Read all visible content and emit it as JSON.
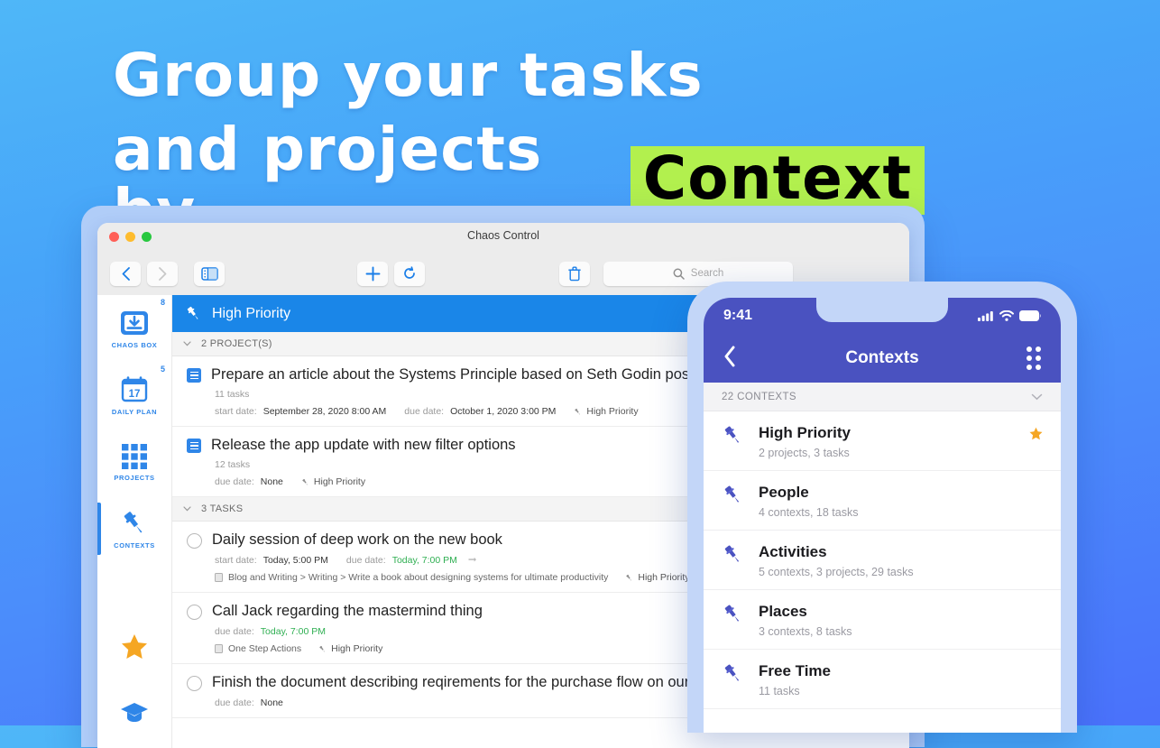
{
  "headline": {
    "line1": "Group your tasks",
    "line2_prefix": "and projects by",
    "line2_highlight": "Context",
    "highlight_color": "#b2f04e"
  },
  "desktop": {
    "window_title": "Chaos Control",
    "toolbar": {
      "back_icon": "chevron-left-icon",
      "forward_icon": "chevron-right-icon",
      "sidebar_toggle_icon": "sidebar-toggle-icon",
      "add_icon": "plus-icon",
      "sync_icon": "refresh-icon",
      "delete_icon": "trash-icon",
      "search_icon": "search-icon",
      "search_placeholder": "Search",
      "search_value": ""
    },
    "sidebar": {
      "items": [
        {
          "label": "CHAOS BOX",
          "badge": "8",
          "icon": "inbox-download-icon",
          "active": false
        },
        {
          "label": "DAILY PLAN",
          "badge": "5",
          "icon": "calendar-17-icon",
          "active": false
        },
        {
          "label": "PROJECTS",
          "badge": "",
          "icon": "grid-icon",
          "active": false
        },
        {
          "label": "CONTEXTS",
          "badge": "",
          "icon": "pin-icon",
          "active": true
        }
      ],
      "extras": [
        {
          "icon": "star-icon",
          "color": "#f5a623"
        },
        {
          "icon": "graduation-cap-icon",
          "color": "#2f86e8"
        }
      ]
    },
    "context_header": {
      "title": "High Priority",
      "icon": "pin-icon",
      "color": "#1a86e8"
    },
    "groups": [
      {
        "label": "2 PROJECT(S)",
        "chevron": "chevron-down-icon",
        "rows": [
          {
            "kind": "project",
            "title": "Prepare an article about the Systems Principle based on Seth Godin posts",
            "subtitle": "11 tasks",
            "meta": [
              {
                "key": "start date:",
                "value": "September 28, 2020 8:00 AM"
              },
              {
                "key": "due date:",
                "value": "October 1, 2020 3:00 PM"
              }
            ],
            "context": "High Priority"
          },
          {
            "kind": "project",
            "title": "Release the app update with new filter options",
            "subtitle": "12 tasks",
            "meta": [
              {
                "key": "due date:",
                "value": "None"
              }
            ],
            "context": "High Priority"
          }
        ]
      },
      {
        "label": "3 TASKS",
        "chevron": "chevron-down-icon",
        "rows": [
          {
            "kind": "task",
            "title": "Daily session of deep work on the new book",
            "meta": [
              {
                "key": "start date:",
                "value": "Today, 5:00 PM"
              },
              {
                "key": "due date:",
                "value": "Today, 7:00 PM",
                "highlight": "green"
              }
            ],
            "repeat_icon": "repeat-icon",
            "path": "Blog and Writing > Writing > Write a book about designing systems for ultimate productivity",
            "context": "High Priority"
          },
          {
            "kind": "task",
            "title": "Call Jack regarding the mastermind thing",
            "meta": [
              {
                "key": "due date:",
                "value": "Today, 7:00 PM",
                "highlight": "green"
              }
            ],
            "path": "One Step Actions",
            "context": "High Priority"
          },
          {
            "kind": "task",
            "title": "Finish the document describing reqirements for the purchase flow on our website",
            "meta": [
              {
                "key": "due date:",
                "value": "None"
              }
            ],
            "path": "",
            "context": ""
          }
        ]
      }
    ]
  },
  "phone": {
    "status": {
      "time": "9:41",
      "signal_icon": "cellular-bars-icon",
      "wifi_icon": "wifi-icon",
      "battery_icon": "battery-full-icon"
    },
    "navbar": {
      "title": "Contexts",
      "back_icon": "chevron-left-icon",
      "menu_icon": "grid-dots-icon"
    },
    "section": {
      "label": "22 CONTEXTS",
      "chevron": "chevron-down-icon"
    },
    "items": [
      {
        "name": "High Priority",
        "sub": "2 projects, 3 tasks",
        "icon": "pin-icon",
        "starred": true,
        "star_icon": "star-icon"
      },
      {
        "name": "People",
        "sub": "4 contexts, 18 tasks",
        "icon": "pin-icon",
        "starred": false
      },
      {
        "name": "Activities",
        "sub": "5 contexts, 3 projects, 29 tasks",
        "icon": "pin-icon",
        "starred": false
      },
      {
        "name": "Places",
        "sub": "3 contexts, 8 tasks",
        "icon": "pin-icon",
        "starred": false
      },
      {
        "name": "Free Time",
        "sub": "11 tasks",
        "icon": "pin-icon",
        "starred": false
      }
    ]
  }
}
